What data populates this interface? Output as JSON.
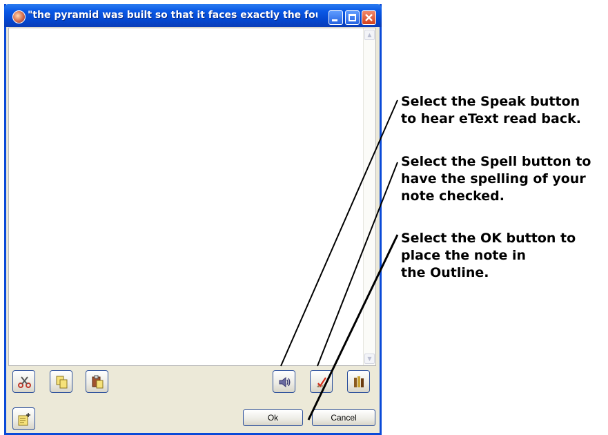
{
  "window": {
    "title": "\"the pyramid was built so that it faces exactly the four ca...",
    "minimize_label": "_",
    "maximize_label": "□",
    "close_label": "X"
  },
  "note_text": "",
  "toolbar": {
    "cut_icon": "scissors-icon",
    "copy_icon": "copy-icon",
    "paste_icon": "paste-icon",
    "speak_icon": "speaker-icon",
    "spell_icon": "spell-check-icon",
    "library_icon": "books-icon",
    "new_note_icon": "new-note-icon",
    "ok_label": "Ok",
    "cancel_label": "Cancel"
  },
  "annotations": [
    {
      "text_line1": "Select the Speak button",
      "text_line2": "to hear eText read back."
    },
    {
      "text_line1": "Select the Spell button to",
      "text_line2": "have the spelling of your",
      "text_line3": "note checked."
    },
    {
      "text_line1": "Select the OK button to",
      "text_line2": "place the note in",
      "text_line3": "the Outline."
    }
  ]
}
